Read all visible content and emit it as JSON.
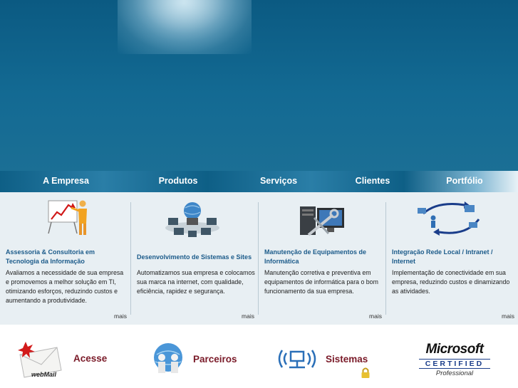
{
  "nav": {
    "items": [
      "A Empresa",
      "Produtos",
      "Serviços",
      "Clientes",
      "Portfólio"
    ]
  },
  "services": [
    {
      "title": "Assessoria & Consultoria em Tecnologia da Informação",
      "text": "Avaliamos a necessidade de sua empresa e promovemos a melhor solução em TI, otimizando esforços, reduzindo custos e aumentando a produtividade.",
      "more": "mais",
      "icon": "presentation-chart-icon"
    },
    {
      "title": "Desenvolvimento de Sistemas e Sites",
      "text": "Automatizamos sua empresa e colocamos sua marca na internet, com qualidade, eficiência, rapidez e segurança.",
      "more": "mais",
      "icon": "globe-network-icon"
    },
    {
      "title": "Manutenção de Equipamentos de Informática",
      "text": "Manutenção corretiva e preventiva em equipamentos de informática para o bom funcionamento da sua empresa.",
      "more": "mais",
      "icon": "computer-tools-icon"
    },
    {
      "title": "Integração Rede Local / Intranet / Internet",
      "text": "Implementação de conectividade em sua empresa, reduzindo custos e dinamizando as atividades.",
      "more": "mais",
      "icon": "network-cycle-icon"
    }
  ],
  "footer": {
    "webmail": {
      "label": "Acesse",
      "logo_text": "webMail"
    },
    "partners": {
      "label": "Parceiros"
    },
    "systems": {
      "label": "Sistemas"
    },
    "microsoft": {
      "brand": "Microsoft",
      "certified": "CERTIFIED",
      "level": "Professional"
    }
  },
  "colors": {
    "hero": "#136a93",
    "nav": "#0e5f86",
    "title_blue": "#1c5b8a",
    "footer_label": "#7a1a28",
    "panel": "#e8eff3"
  }
}
